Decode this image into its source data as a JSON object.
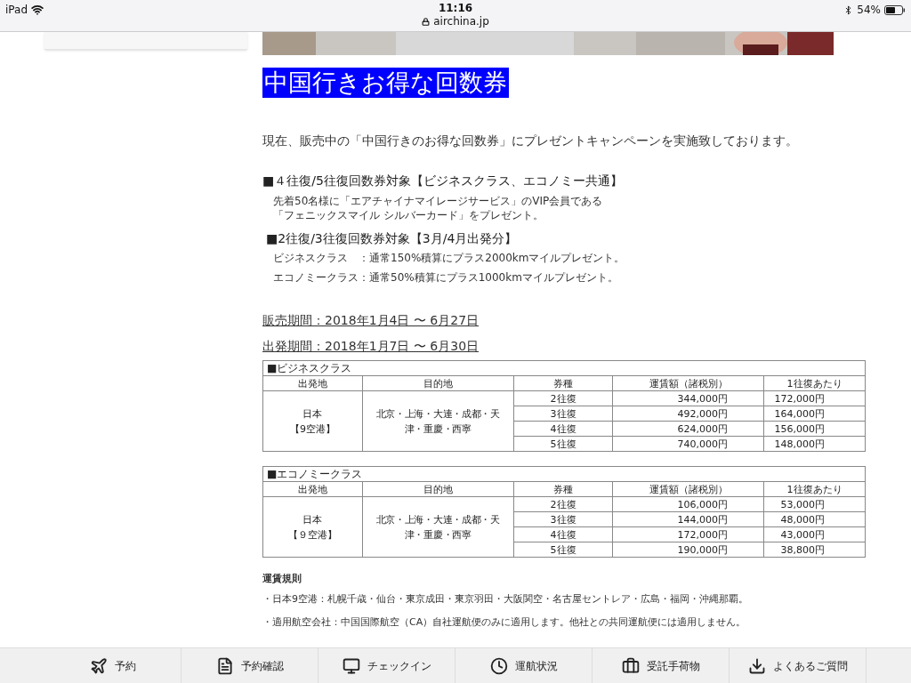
{
  "status_bar": {
    "device": "iPad",
    "time": "11:16",
    "url": "airchina.jp",
    "battery": "54%"
  },
  "title": "中国行きお得な回数券",
  "intro": "現在、販売中の「中国行きのお得な回数券」にプレゼントキャンペーンを実施致しております。",
  "sections": [
    {
      "heading": "■４往復/5往復回数券対象【ビジネスクラス、エコノミー共通】",
      "lines": [
        "先着50名様に「エアチャイナマイレージサービス」のVIP会員である",
        "「フェニックスマイル シルバーカード」をプレゼント。"
      ],
      "kind": "block"
    },
    {
      "heading": "■2往復/3往復回数券対象【3月/4月出発分】",
      "lines": [
        "ビジネスクラス　：通常150%積算にプラス2000kmマイルプレゼント。",
        "エコノミークラス：通常50%積算にプラス1000kmマイルプレゼント。"
      ],
      "kind": "spaced"
    }
  ],
  "periods": [
    "販売期間：2018年1月4日 〜 6月27日",
    "出発期間：2018年1月7日 〜 6月30日"
  ],
  "tables": [
    {
      "title": "■ビジネスクラス",
      "columns": [
        "出発地",
        "目的地",
        "券種",
        "運賃額（諸税別）",
        "1往復あたり"
      ],
      "rows": [
        [
          {
            "text": "日本【9空港】",
            "rowspan": 4
          },
          {
            "text": "北京・上海・大連・成都・天津・重慶・西寧",
            "rowspan": 4
          },
          "2往復",
          "344,000円",
          "172,000円"
        ],
        [
          "3往復",
          "492,000円",
          "164,000円"
        ],
        [
          "4往復",
          "624,000円",
          "156,000円"
        ],
        [
          "5往復",
          "740,000円",
          "148,000円"
        ]
      ]
    },
    {
      "title": "■エコノミークラス",
      "columns": [
        "出発地",
        "目的地",
        "券種",
        "運賃額（諸税別）",
        "1往復あたり"
      ],
      "rows": [
        [
          {
            "text": "日本【９空港】",
            "rowspan": 4
          },
          {
            "text": "北京・上海・大連・成都・天津・重慶・西寧",
            "rowspan": 4
          },
          "2往復",
          "106,000円",
          "53,000円"
        ],
        [
          "3往復",
          "144,000円",
          "48,000円"
        ],
        [
          "4往復",
          "172,000円",
          "43,000円"
        ],
        [
          "5往復",
          "190,000円",
          "38,800円"
        ]
      ]
    }
  ],
  "rules": {
    "heading": "運賃規則",
    "items": [
      "・日本9空港：札幌千歳・仙台・東京成田・東京羽田・大阪関空・名古屋セントレア・広島・福岡・沖縄那覇。",
      "・適用航空会社：中国国際航空（CA）自社運航便のみに適用します。他社との共同運航便には適用しません。"
    ]
  },
  "tab_bar": [
    {
      "label": "予約",
      "kind": "plane"
    },
    {
      "label": "予約確認",
      "kind": "document"
    },
    {
      "label": "チェックイン",
      "kind": "monitor"
    },
    {
      "label": "運航状況",
      "kind": "clock"
    },
    {
      "label": "受託手荷物",
      "kind": "suitcase"
    },
    {
      "label": "よくあるご質問",
      "kind": "download"
    }
  ]
}
